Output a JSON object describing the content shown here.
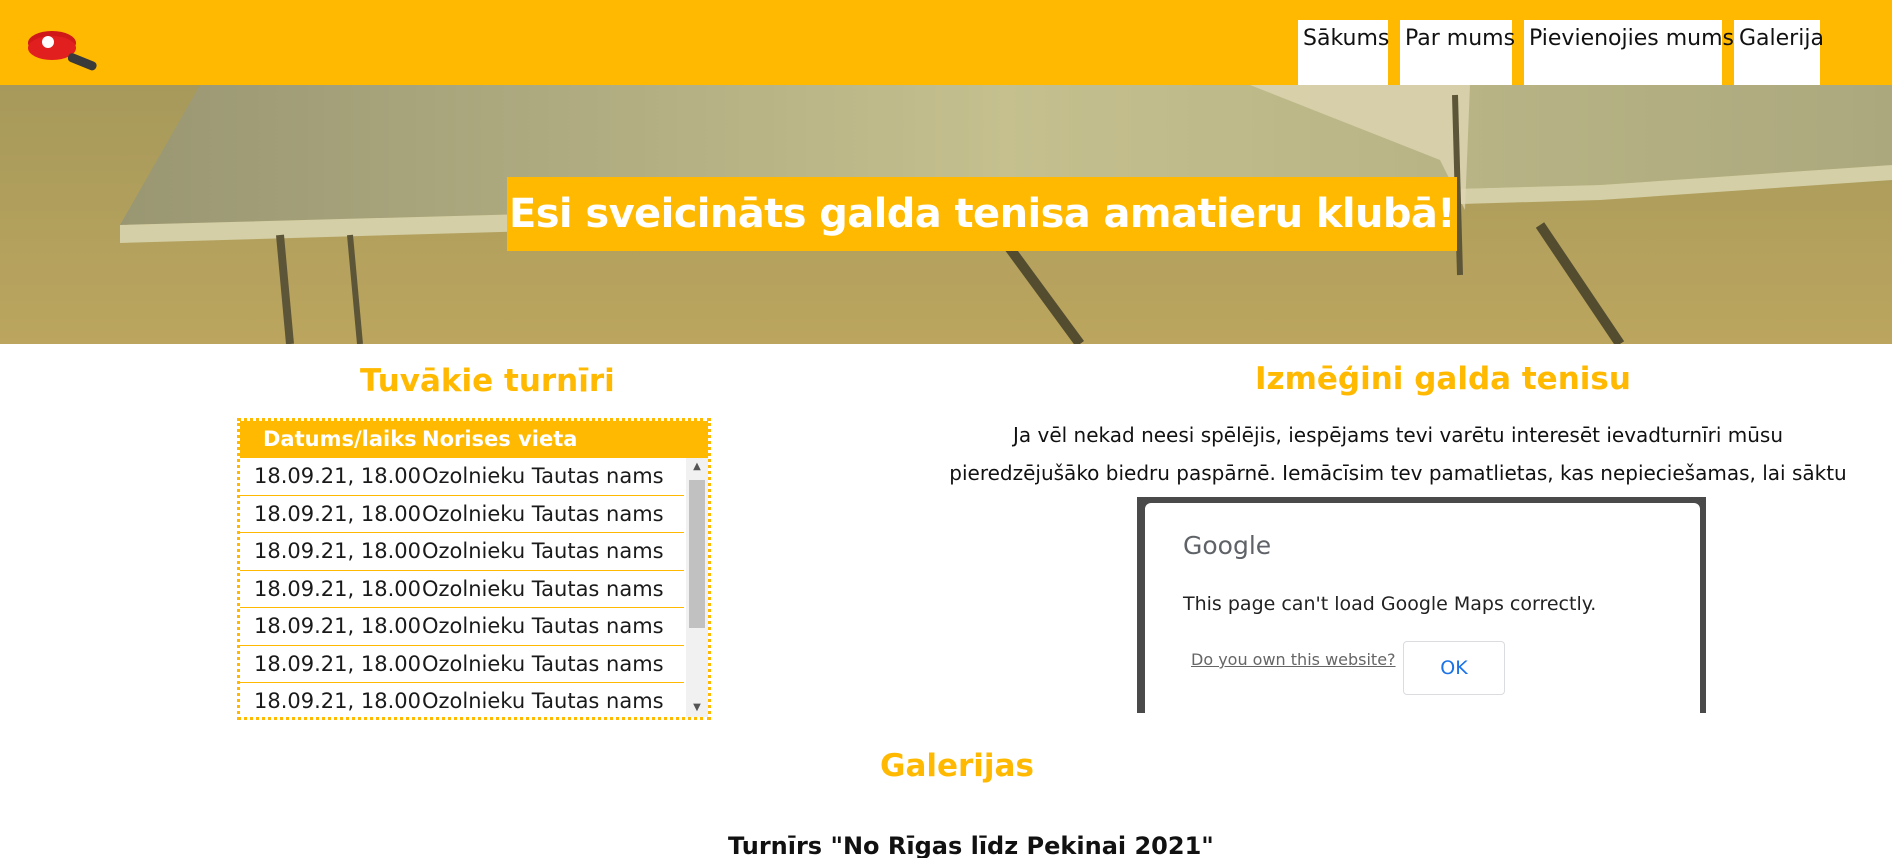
{
  "nav": {
    "items": [
      {
        "label": "Sākums"
      },
      {
        "label": "Par mums"
      },
      {
        "label": "Pievienojies mums"
      },
      {
        "label": "Galerija"
      }
    ]
  },
  "hero": {
    "title": "Esi sveicināts galda tenisa amatieru klubā!"
  },
  "tournaments": {
    "title": "Tuvākie turnīri",
    "headers": [
      "Datums/laiks",
      "Norises vieta"
    ],
    "rows": [
      [
        "18.09.21, 18.00",
        "Ozolnieku Tautas nams"
      ],
      [
        "18.09.21, 18.00",
        "Ozolnieku Tautas nams"
      ],
      [
        "18.09.21, 18.00",
        "Ozolnieku Tautas nams"
      ],
      [
        "18.09.21, 18.00",
        "Ozolnieku Tautas nams"
      ],
      [
        "18.09.21, 18.00",
        "Ozolnieku Tautas nams"
      ],
      [
        "18.09.21, 18.00",
        "Ozolnieku Tautas nams"
      ],
      [
        "18.09.21, 18.00",
        "Ozolnieku Tautas nams"
      ]
    ]
  },
  "try": {
    "title": "Izmēģini galda tenisu",
    "text": "Ja vēl nekad neesi spēlējis, iespējams tevi varētu interesēt ievadturnīri mūsu pieredzējušāko biedru paspārnē. Iemācīsim tev pamatlietas, kas nepieciešamas, lai sāktu spēlēt."
  },
  "map_dialog": {
    "logo": "Google",
    "message": "This page can't load Google Maps correctly.",
    "link": "Do you own this website?",
    "ok": "OK"
  },
  "gallery": {
    "title": "Galerijas",
    "subtitle": "Turnīrs \"No Rīgas līdz Pekinai 2021\""
  },
  "colors": {
    "accent": "#ffb900"
  },
  "icons": {
    "logo": "ping-pong-paddle-icon"
  }
}
